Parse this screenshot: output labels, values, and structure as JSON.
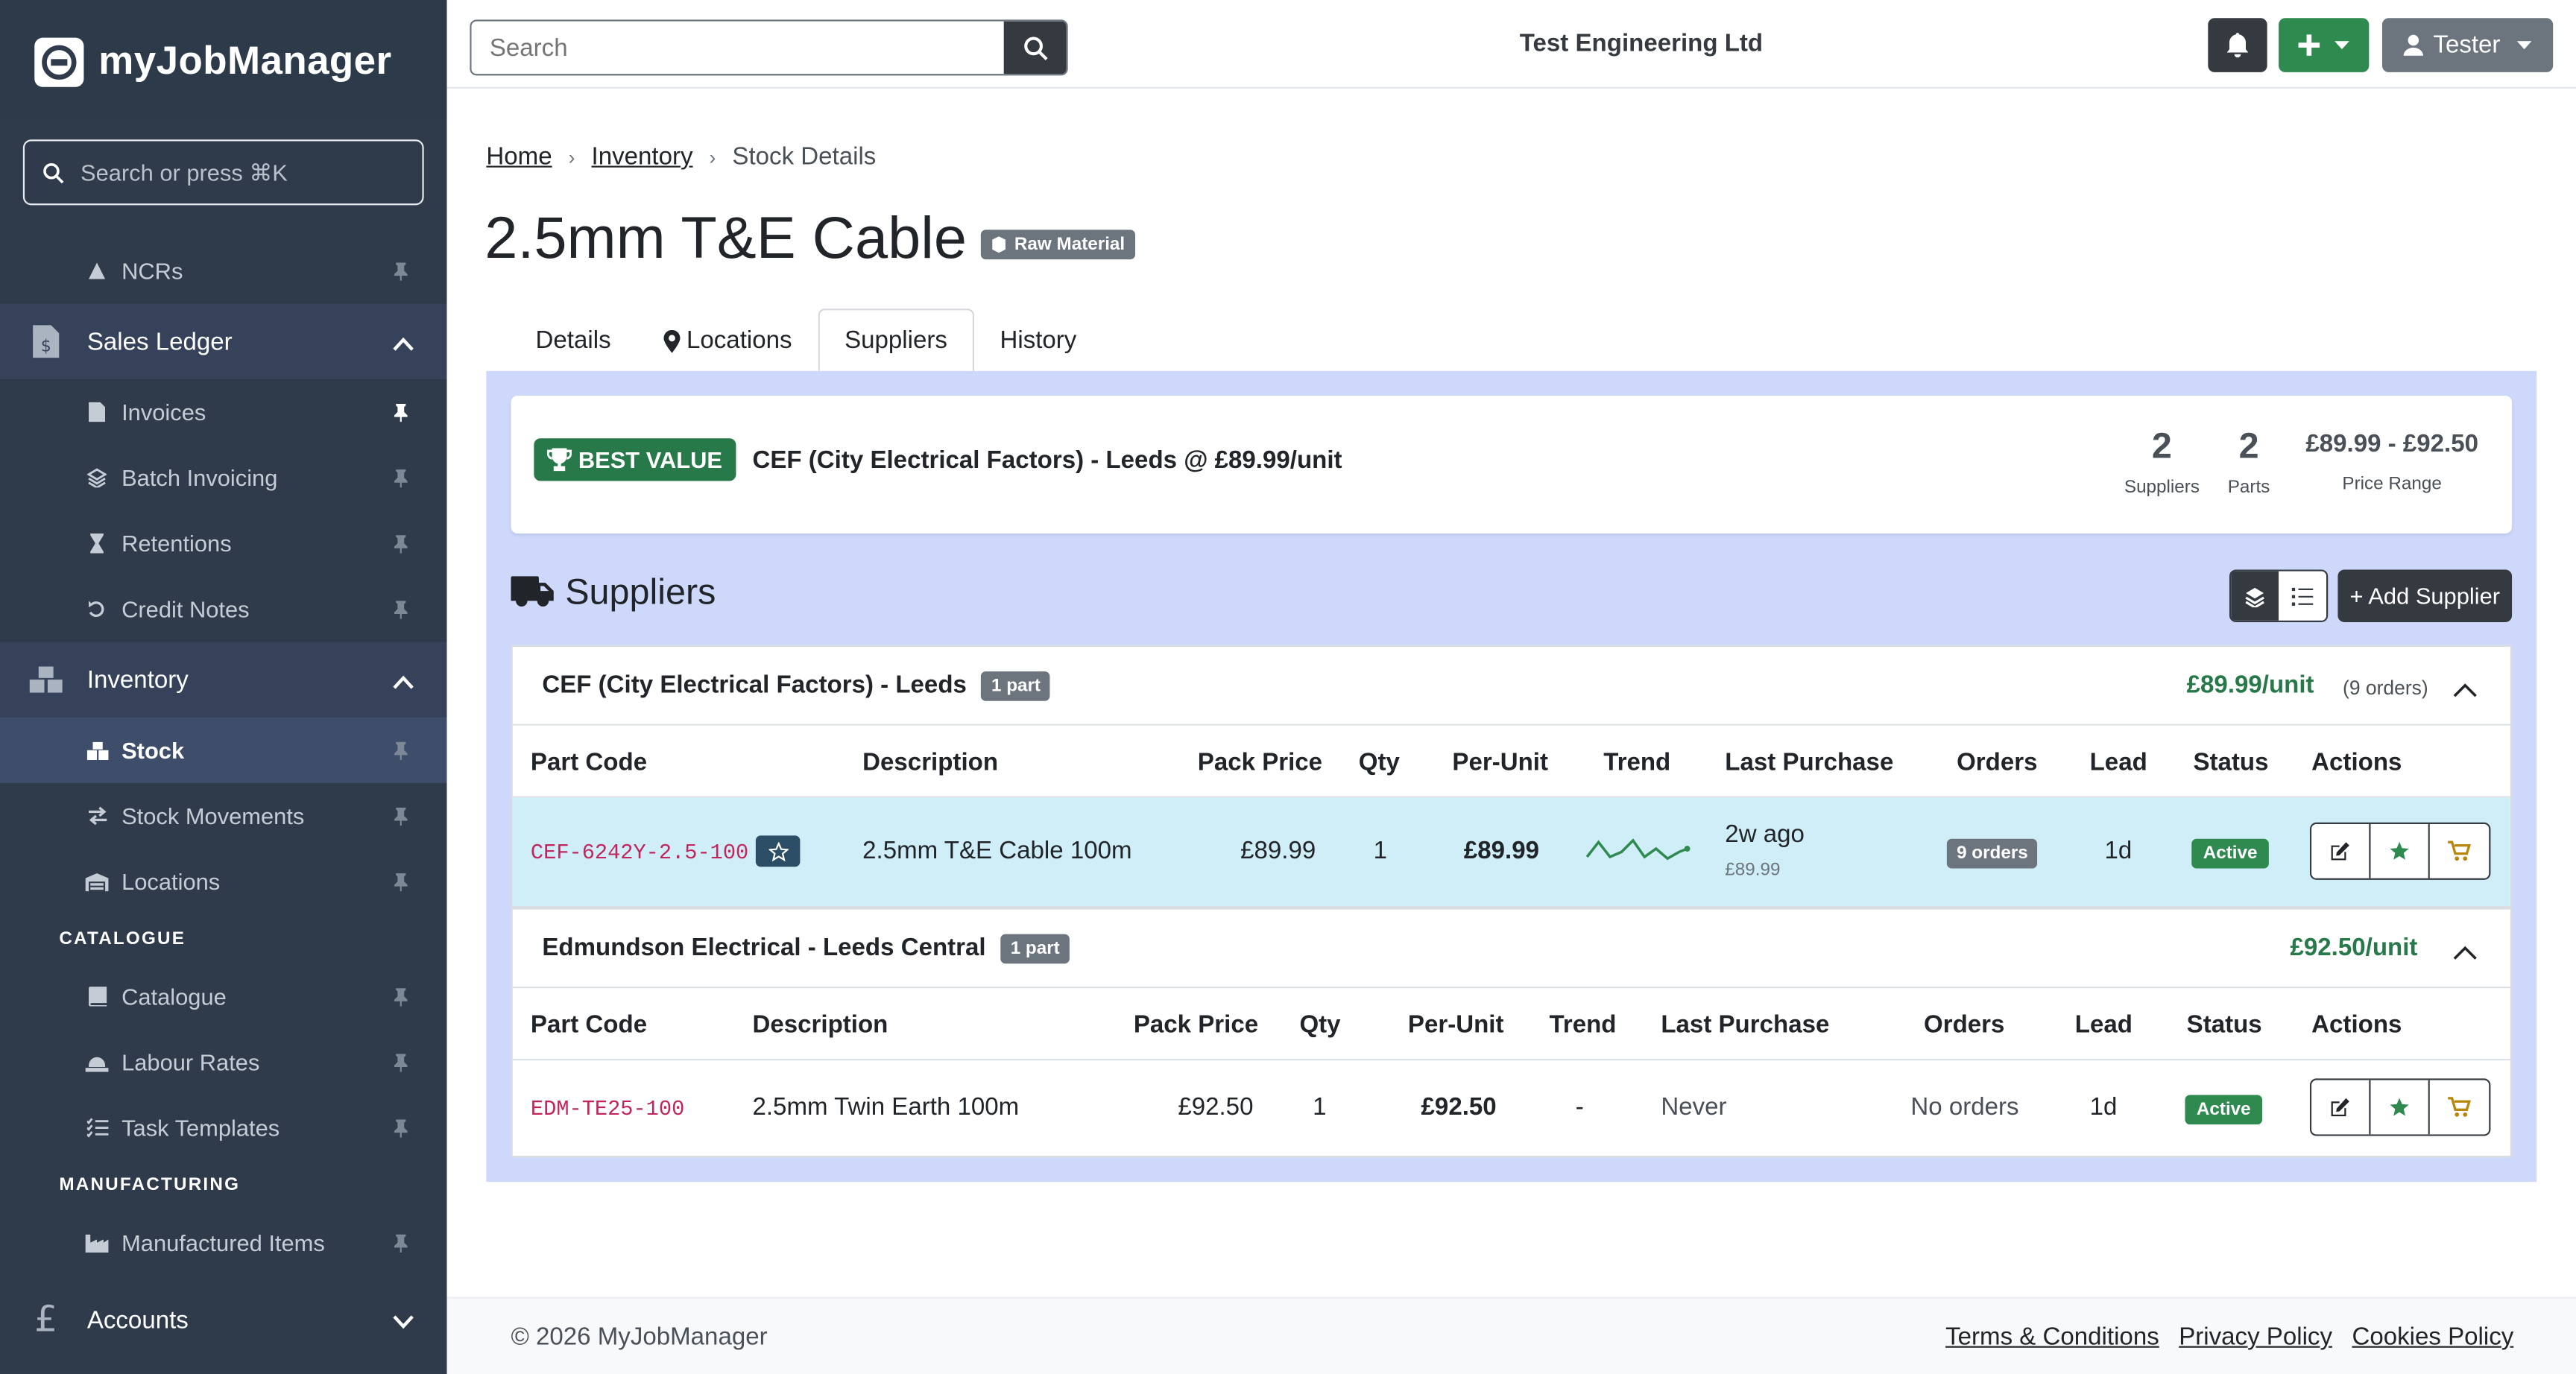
{
  "app": {
    "name": "myJobManager"
  },
  "sidebar": {
    "search_placeholder": "Search or press ⌘K",
    "items": {
      "ncrs": "NCRs",
      "sales_ledger": "Sales Ledger",
      "invoices": "Invoices",
      "batch_invoicing": "Batch Invoicing",
      "retentions": "Retentions",
      "credit_notes": "Credit Notes",
      "inventory": "Inventory",
      "stock": "Stock",
      "stock_movements": "Stock Movements",
      "locations": "Locations",
      "catalogue_header": "CATALOGUE",
      "catalogue": "Catalogue",
      "labour_rates": "Labour Rates",
      "task_templates": "Task Templates",
      "manufacturing_header": "MANUFACTURING",
      "manufactured_items": "Manufactured Items",
      "accounts": "Accounts"
    }
  },
  "topbar": {
    "search_placeholder": "Search",
    "company": "Test Engineering Ltd",
    "user": "Tester"
  },
  "breadcrumb": {
    "home": "Home",
    "inventory": "Inventory",
    "current": "Stock Details"
  },
  "page": {
    "title": "2.5mm T&E Cable",
    "type_badge": "Raw Material"
  },
  "tabs": [
    "Details",
    "Locations",
    "Suppliers",
    "History"
  ],
  "summary": {
    "best_label": "BEST VALUE",
    "best_text": "CEF (City Electrical Factors) - Leeds @ £89.99/unit",
    "suppliers_n": "2",
    "suppliers_l": "Suppliers",
    "parts_n": "2",
    "parts_l": "Parts",
    "range": "£89.99 - £92.50",
    "range_l": "Price Range"
  },
  "suppliers_section": {
    "title": "Suppliers",
    "add_label": "+ Add Supplier"
  },
  "columns": [
    "Part Code",
    "Description",
    "Pack Price",
    "Qty",
    "Per-Unit",
    "Trend",
    "Last Purchase",
    "Orders",
    "Lead",
    "Status",
    "Actions"
  ],
  "suppliers": [
    {
      "name": "CEF (City Electrical Factors) - Leeds",
      "parts_badge": "1 part",
      "unit_price": "£89.99/unit",
      "orders_note": "(9 orders)",
      "row": {
        "code": "CEF-6242Y-2.5-100",
        "description": "2.5mm T&E Cable 100m",
        "pack_price": "£89.99",
        "qty": "1",
        "per_unit": "£89.99",
        "last_purchase": "2w ago",
        "last_price": "£89.99",
        "orders": "9 orders",
        "lead": "1d",
        "status": "Active"
      }
    },
    {
      "name": "Edmundson Electrical - Leeds Central",
      "parts_badge": "1 part",
      "unit_price": "£92.50/unit",
      "row": {
        "code": "EDM-TE25-100",
        "description": "2.5mm Twin Earth 100m",
        "pack_price": "£92.50",
        "qty": "1",
        "per_unit": "£92.50",
        "trend": "-",
        "last_purchase": "Never",
        "orders": "No orders",
        "lead": "1d",
        "status": "Active"
      }
    }
  ],
  "footer": {
    "copyright": "© 2026 MyJobManager",
    "terms": "Terms & Conditions",
    "privacy": "Privacy Policy",
    "cookies": "Cookies Policy"
  },
  "colors": {
    "sidebar": "#2f3b4b",
    "accent_green": "#28794a",
    "panel": "#cdd8fb",
    "code_pink": "#c2255c"
  }
}
